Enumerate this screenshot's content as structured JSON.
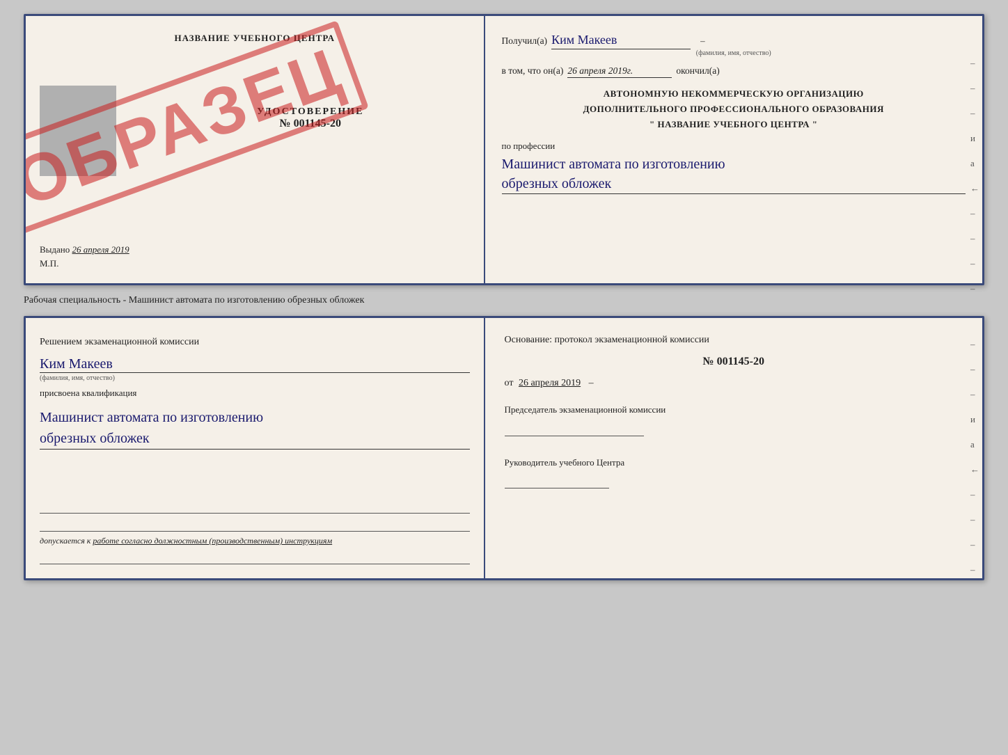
{
  "page": {
    "background": "#c8c8c8"
  },
  "top_doc": {
    "left": {
      "title": "НАЗВАНИЕ УЧЕБНОГО ЦЕНТРА",
      "doc_label": "УДОСТОВЕРЕНИЕ",
      "doc_number": "№ 001145-20",
      "issued_prefix": "Выдано",
      "issued_date": "26 апреля 2019",
      "mp_label": "М.П.",
      "stamp_text": "ОБРАЗЕЦ"
    },
    "right": {
      "recipient_prefix": "Получил(а)",
      "recipient_name": "Ким Макеев",
      "recipient_sublabel": "(фамилия, имя, отчество)",
      "date_prefix": "в том, что он(а)",
      "date_value": "26 апреля 2019г.",
      "date_suffix": "окончил(а)",
      "org_line1": "АВТОНОМНУЮ НЕКОММЕРЧЕСКУЮ ОРГАНИЗАЦИЮ",
      "org_line2": "ДОПОЛНИТЕЛЬНОГО ПРОФЕССИОНАЛЬНОГО ОБРАЗОВАНИЯ",
      "org_line3": "\"  НАЗВАНИЕ УЧЕБНОГО ЦЕНТРА  \"",
      "profession_prefix": "по профессии",
      "profession_line1": "Машинист автомата по изготовлению",
      "profession_line2": "обрезных обложек"
    }
  },
  "caption": {
    "text": "Рабочая специальность - Машинист автомата по изготовлению обрезных обложек"
  },
  "bottom_doc": {
    "left": {
      "heading": "Решением экзаменационной комиссии",
      "person_name": "Ким Макеев",
      "fio_label": "(фамилия, имя, отчество)",
      "assigned_label": "присвоена квалификация",
      "profession_line1": "Машинист автомата по изготовлению",
      "profession_line2": "обрезных обложек",
      "допускается_prefix": "допускается к",
      "допускается_value": "работе согласно должностным (производственным) инструкциям"
    },
    "right": {
      "heading": "Основание: протокол экзаменационной комиссии",
      "protocol_number": "№ 001145-20",
      "date_prefix": "от",
      "date_value": "26 апреля 2019",
      "chairman_label": "Председатель экзаменационной комиссии",
      "head_label": "Руководитель учебного Центра"
    }
  },
  "side_marks": {
    "marks": [
      "–",
      "–",
      "–",
      "и",
      "а",
      "←",
      "–",
      "–",
      "–",
      "–"
    ]
  }
}
